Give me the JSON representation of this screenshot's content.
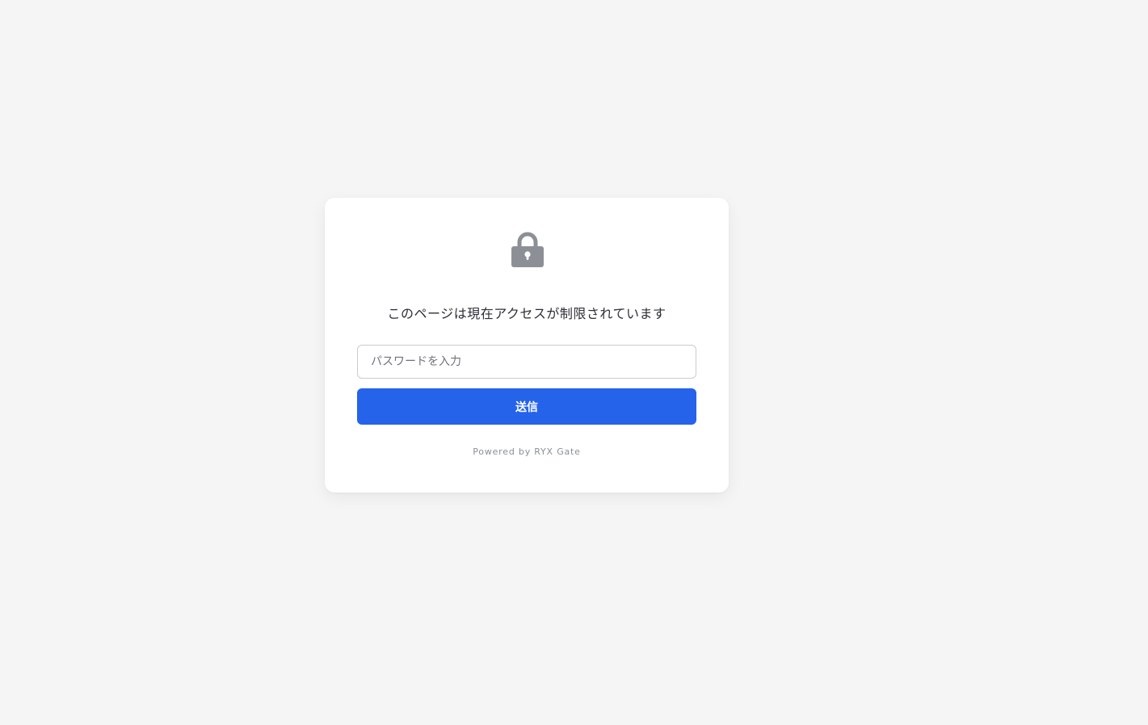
{
  "gate": {
    "icon": "lock-icon",
    "message": "このページは現在アクセスが制限されています",
    "password_placeholder": "パスワードを入力",
    "password_value": "",
    "submit_label": "送信",
    "powered_by": "Powered by RYX Gate"
  },
  "colors": {
    "background": "#f5f5f5",
    "card": "#ffffff",
    "accent": "#2563eb",
    "icon": "#8c9096"
  }
}
